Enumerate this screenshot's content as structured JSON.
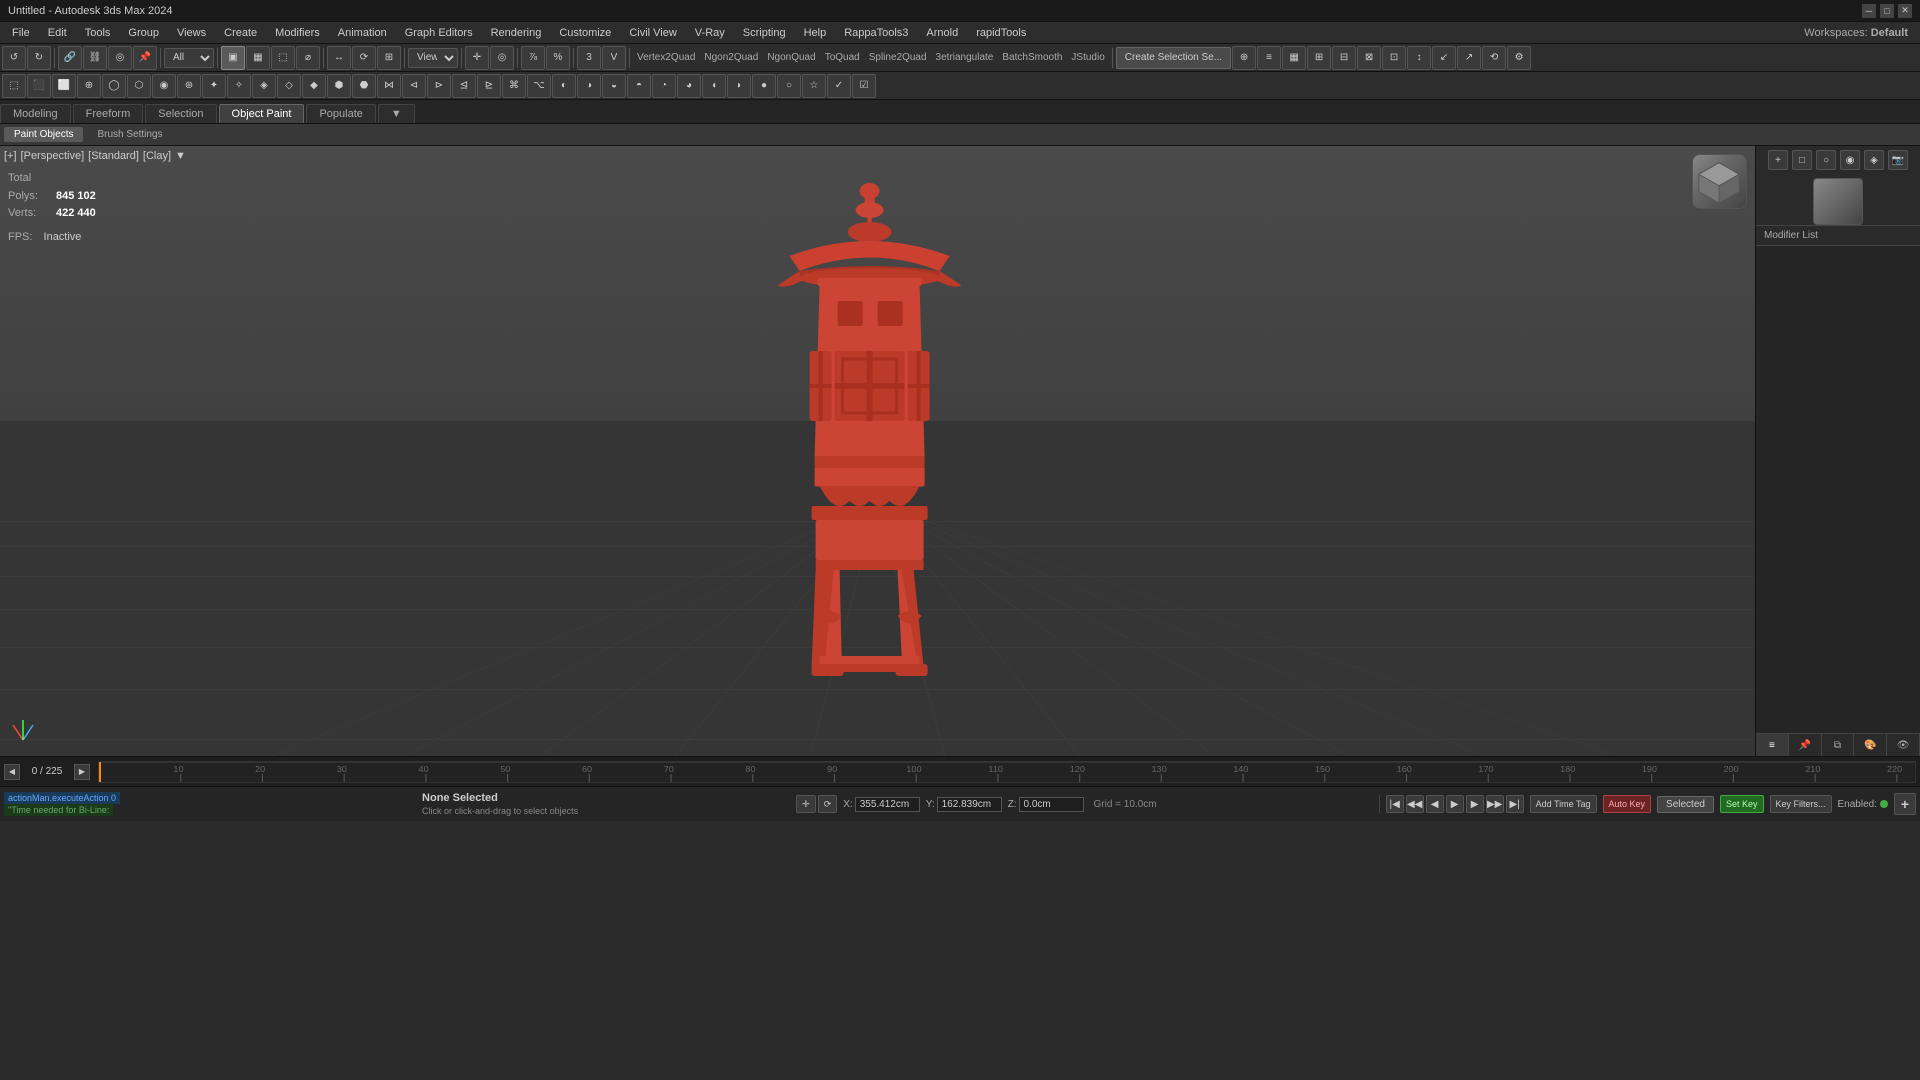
{
  "titleBar": {
    "title": "Untitled - Autodesk 3ds Max 2024",
    "minimize": "─",
    "maximize": "□",
    "close": "✕"
  },
  "menuBar": {
    "items": [
      "File",
      "Edit",
      "Tools",
      "Group",
      "Views",
      "Create",
      "Modifiers",
      "Animation",
      "Graph Editors",
      "Rendering",
      "Customize",
      "Civil View",
      "V-Ray",
      "Scripting",
      "Help",
      "RappaTools3",
      "Arnold",
      "rapidTools"
    ]
  },
  "workspaces": {
    "label": "Workspaces:",
    "value": "Default"
  },
  "toolbar1": {
    "create_selection_btn": "Create Selection Se...",
    "view_dropdown": "View"
  },
  "tabs": {
    "items": [
      "Modeling",
      "Freeform",
      "Selection",
      "Object Paint",
      "Populate"
    ]
  },
  "subtabs": {
    "items": [
      "Paint Objects",
      "Brush Settings"
    ]
  },
  "viewport": {
    "label": "[+] [Perspective] [Standard] [Clay]",
    "parts": [
      "[+]",
      "[Perspective]",
      "[Standard]",
      "[Clay]"
    ]
  },
  "stats": {
    "total_label": "Total",
    "polys_label": "Polys:",
    "polys_value": "845 102",
    "verts_label": "Verts:",
    "verts_value": "422 440",
    "fps_label": "FPS:",
    "fps_value": "Inactive"
  },
  "timeline": {
    "frame_current": "0 / 225",
    "ticks": [
      "10",
      "20",
      "30",
      "40",
      "50",
      "60",
      "70",
      "80",
      "90",
      "100",
      "110",
      "120",
      "130",
      "140",
      "150",
      "160",
      "170",
      "180",
      "190",
      "200",
      "210",
      "220"
    ]
  },
  "statusBar": {
    "none_selected": "None Selected",
    "hint": "Click or click-and-drag to select objects",
    "script_line1": "actionMan.executeAction 0",
    "script_line2": "\"Time needed for Bi-Line:",
    "x_label": "X:",
    "x_value": "355.412cm",
    "y_label": "Y:",
    "y_value": "162.839cm",
    "z_label": "Z:",
    "z_value": "0.0cm",
    "grid_label": "Grid = 10.0cm",
    "enabled_label": "Enabled:",
    "add_time_tag": "Add Time Tag",
    "auto_key": "Auto Key",
    "selected": "Selected",
    "set_key": "Set Key",
    "key_filters": "Key Filters...",
    "add_icon": "+"
  },
  "rightPanel": {
    "modifier_list_label": "Modifier List",
    "tabs": [
      "list",
      "pin",
      "stack",
      "color",
      "eye"
    ]
  },
  "colors": {
    "accent": "#cc4433",
    "bg_dark": "#1e1e1e",
    "bg_mid": "#2a2a2a",
    "bg_light": "#3a3a3a",
    "text_normal": "#cccccc",
    "text_dim": "#888888",
    "selected_bg": "#444444",
    "lantern_color": "#cc4433"
  }
}
